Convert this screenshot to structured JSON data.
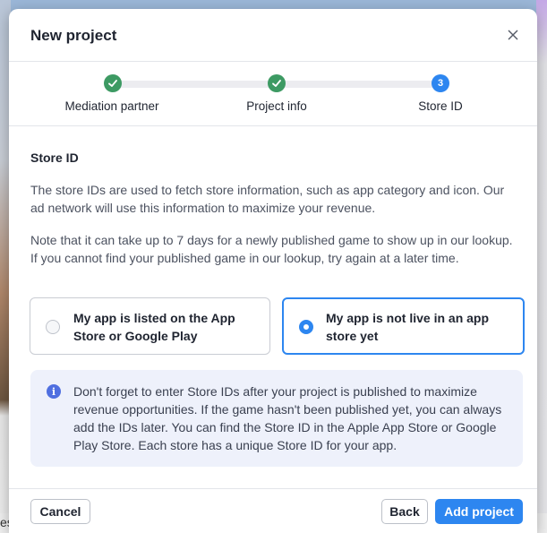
{
  "background": {
    "edge_text": "es"
  },
  "dialog": {
    "title": "New project",
    "close_icon": "close-icon"
  },
  "stepper": {
    "steps": [
      {
        "label": "Mediation partner",
        "state": "completed",
        "icon": "check-icon"
      },
      {
        "label": "Project info",
        "state": "completed",
        "icon": "check-icon"
      },
      {
        "label": "Store ID",
        "state": "active",
        "number": "3"
      }
    ]
  },
  "content": {
    "section_title": "Store ID",
    "para1": "The store IDs are used to fetch store information, such as app category and icon. Our ad network will use this information to maximize your revenue.",
    "para2": "Note that it can take up to 7 days for a newly published game to show up in our lookup. If you cannot find your published game in our lookup, try again at a later time.",
    "options": [
      {
        "label": "My app is listed on the App Store or Google Play",
        "selected": false
      },
      {
        "label": "My app is not live in an app store yet",
        "selected": true
      }
    ],
    "info": {
      "icon": "info-icon",
      "icon_glyph": "i",
      "text": "Don't forget to enter Store IDs after your project is published to maximize revenue opportunities. If the game hasn't been published yet, you can always add the IDs later. You can find the Store ID in the Apple App Store or Google Play Store. Each store has a unique Store ID for your app."
    }
  },
  "footer": {
    "cancel_label": "Cancel",
    "back_label": "Back",
    "add_label": "Add project"
  },
  "colors": {
    "accent": "#2d86f0",
    "success": "#3d9a63",
    "info_bg": "#eef1fb"
  }
}
